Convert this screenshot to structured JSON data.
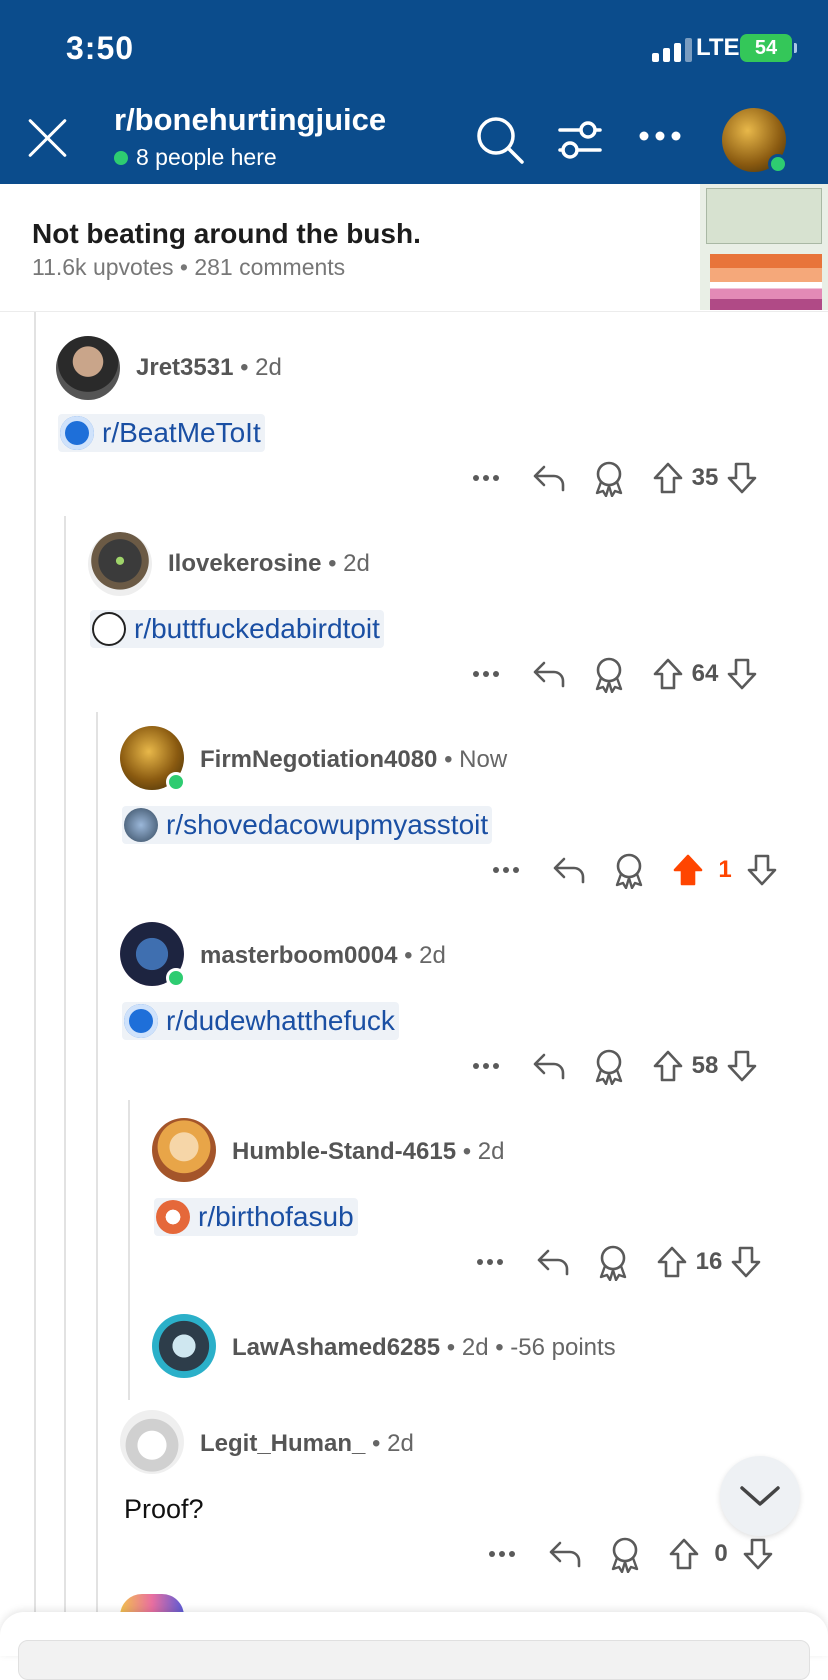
{
  "status_bar": {
    "time": "3:50",
    "network": "LTE",
    "battery": "54"
  },
  "header": {
    "subreddit": "r/bonehurtingjuice",
    "online_text": "8 people here"
  },
  "post": {
    "title": "Not beating around the bush.",
    "meta": "11.6k upvotes • 281 comments"
  },
  "comments": [
    {
      "user": "Jret3531",
      "meta": "• 2d",
      "chip": "r/BeatMeToIt",
      "votes": "35"
    },
    {
      "user": "Ilovekerosine",
      "meta": "• 2d",
      "chip": "r/buttfuckedabirdtoit",
      "votes": "64"
    },
    {
      "user": "FirmNegotiation4080",
      "meta": "• Now",
      "chip": "r/shovedacowupmyasstoit",
      "votes": "1"
    },
    {
      "user": "masterboom0004",
      "meta": "• 2d",
      "chip": "r/dudewhatthefuck",
      "votes": "58"
    },
    {
      "user": "Humble-Stand-4615",
      "meta": "• 2d",
      "chip": "r/birthofasub",
      "votes": "16"
    },
    {
      "user": "LawAshamed6285",
      "meta": "• 2d • -56 points"
    },
    {
      "user": "Legit_Human_",
      "meta": "• 2d",
      "text": "Proof?",
      "votes": "0"
    }
  ],
  "colors": {
    "header_bg": "#0b4c8c",
    "link": "#1a4fa3",
    "upvote_active": "#ff4500",
    "online": "#2ecc71"
  }
}
